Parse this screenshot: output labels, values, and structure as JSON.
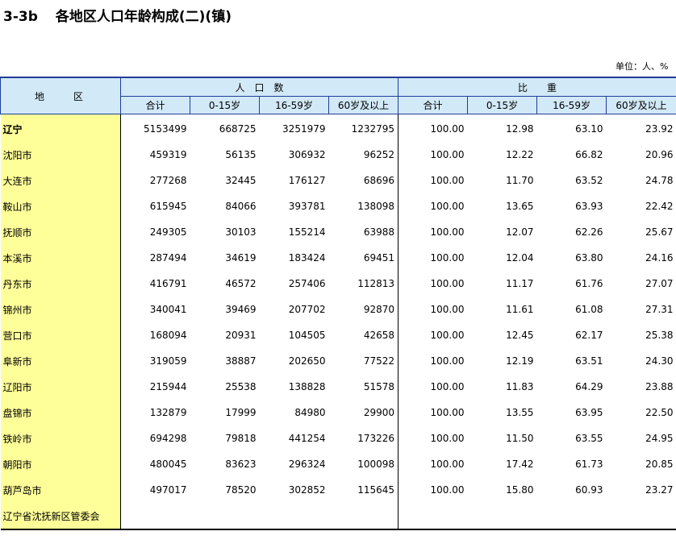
{
  "header": {
    "code": "3-3b",
    "title": "各地区人口年龄构成(二)(镇)",
    "unit": "单位：人、%"
  },
  "table": {
    "region_header": "地　　区",
    "groups": [
      "人　口　数",
      "比　　重"
    ],
    "columns": [
      "合计",
      "0-15岁",
      "16-59岁",
      "60岁及以上",
      "合计",
      "0-15岁",
      "16-59岁",
      "60岁及以上"
    ],
    "rows": [
      {
        "name": "辽宁",
        "values": [
          "5153499",
          "668725",
          "3251979",
          "1232795",
          "100.00",
          "12.98",
          "63.10",
          "23.92"
        ]
      },
      {
        "name": "沈阳市",
        "values": [
          "459319",
          "56135",
          "306932",
          "96252",
          "100.00",
          "12.22",
          "66.82",
          "20.96"
        ]
      },
      {
        "name": "大连市",
        "values": [
          "277268",
          "32445",
          "176127",
          "68696",
          "100.00",
          "11.70",
          "63.52",
          "24.78"
        ]
      },
      {
        "name": "鞍山市",
        "values": [
          "615945",
          "84066",
          "393781",
          "138098",
          "100.00",
          "13.65",
          "63.93",
          "22.42"
        ]
      },
      {
        "name": "抚顺市",
        "values": [
          "249305",
          "30103",
          "155214",
          "63988",
          "100.00",
          "12.07",
          "62.26",
          "25.67"
        ]
      },
      {
        "name": "本溪市",
        "values": [
          "287494",
          "34619",
          "183424",
          "69451",
          "100.00",
          "12.04",
          "63.80",
          "24.16"
        ]
      },
      {
        "name": "丹东市",
        "values": [
          "416791",
          "46572",
          "257406",
          "112813",
          "100.00",
          "11.17",
          "61.76",
          "27.07"
        ]
      },
      {
        "name": "锦州市",
        "values": [
          "340041",
          "39469",
          "207702",
          "92870",
          "100.00",
          "11.61",
          "61.08",
          "27.31"
        ]
      },
      {
        "name": "营口市",
        "values": [
          "168094",
          "20931",
          "104505",
          "42658",
          "100.00",
          "12.45",
          "62.17",
          "25.38"
        ]
      },
      {
        "name": "阜新市",
        "values": [
          "319059",
          "38887",
          "202650",
          "77522",
          "100.00",
          "12.19",
          "63.51",
          "24.30"
        ]
      },
      {
        "name": "辽阳市",
        "values": [
          "215944",
          "25538",
          "138828",
          "51578",
          "100.00",
          "11.83",
          "64.29",
          "23.88"
        ]
      },
      {
        "name": "盘锦市",
        "values": [
          "132879",
          "17999",
          "84980",
          "29900",
          "100.00",
          "13.55",
          "63.95",
          "22.50"
        ]
      },
      {
        "name": "铁岭市",
        "values": [
          "694298",
          "79818",
          "441254",
          "173226",
          "100.00",
          "11.50",
          "63.55",
          "24.95"
        ]
      },
      {
        "name": "朝阳市",
        "values": [
          "480045",
          "83623",
          "296324",
          "100098",
          "100.00",
          "17.42",
          "61.73",
          "20.85"
        ]
      },
      {
        "name": "葫芦岛市",
        "values": [
          "497017",
          "78520",
          "302852",
          "115645",
          "100.00",
          "15.80",
          "60.93",
          "23.27"
        ]
      },
      {
        "name": "辽宁省沈抚新区管委会",
        "values": [
          "",
          "",
          "",
          "",
          "",
          "",
          "",
          ""
        ]
      }
    ]
  }
}
